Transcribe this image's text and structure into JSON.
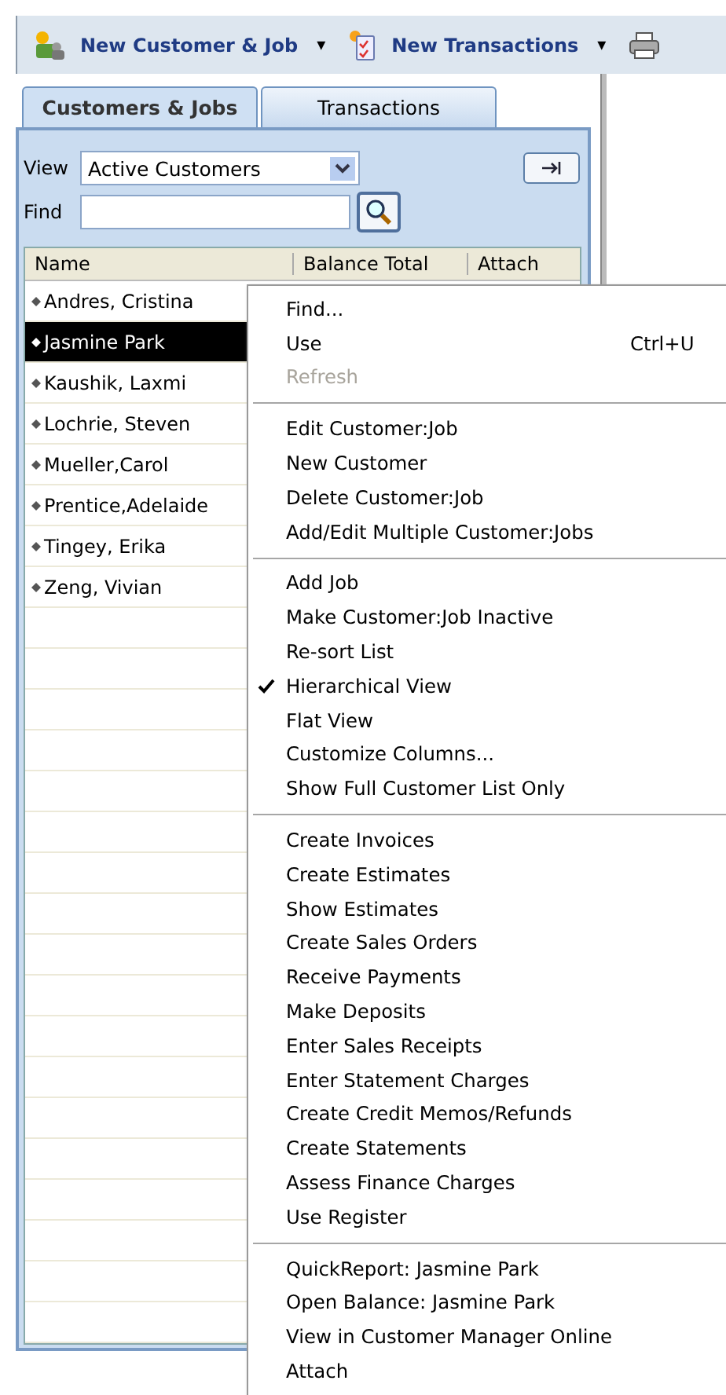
{
  "toolbar": {
    "buttons": [
      {
        "kind": "customer",
        "label": "New Customer & Job",
        "dropdown": "▾"
      },
      {
        "kind": "transaction",
        "label": "New Transactions",
        "dropdown": "▾"
      },
      {
        "kind": "print"
      }
    ]
  },
  "tabs": [
    {
      "label": "Customers & Jobs",
      "selected": true
    },
    {
      "label": "Transactions",
      "selected": false
    }
  ],
  "view": {
    "label": "View",
    "value": "Active Customers"
  },
  "find": {
    "label": "Find"
  },
  "table": {
    "columns": [
      "Name",
      "Balance Total",
      "Attach"
    ],
    "rows": [
      {
        "name": "Andres, Cristina",
        "selected": false
      },
      {
        "name": "Jasmine Park",
        "selected": true
      },
      {
        "name": "Kaushik, Laxmi",
        "selected": false
      },
      {
        "name": "Lochrie, Steven",
        "selected": false
      },
      {
        "name": "Mueller,Carol",
        "selected": false
      },
      {
        "name": "Prentice,Adelaide",
        "selected": false
      },
      {
        "name": "Tingey, Erika",
        "selected": false
      },
      {
        "name": "Zeng, Vivian",
        "selected": false
      }
    ]
  },
  "context_menu": {
    "groups": [
      [
        {
          "label": "Find...",
          "checked": false,
          "disabled": false
        },
        {
          "label": "Use",
          "shortcut": "Ctrl+U",
          "checked": false,
          "disabled": false
        },
        {
          "label": "Refresh",
          "checked": false,
          "disabled": true
        }
      ],
      [
        {
          "label": "Edit Customer:Job",
          "checked": false,
          "disabled": false
        },
        {
          "label": "New Customer",
          "checked": false,
          "disabled": false
        },
        {
          "label": "Delete Customer:Job",
          "checked": false,
          "disabled": false
        },
        {
          "label": "Add/Edit Multiple Customer:Jobs",
          "checked": false,
          "disabled": false
        }
      ],
      [
        {
          "label": "Add Job",
          "checked": false,
          "disabled": false
        },
        {
          "label": "Make Customer:Job Inactive",
          "checked": false,
          "disabled": false
        },
        {
          "label": "Re-sort List",
          "checked": false,
          "disabled": false
        },
        {
          "label": "Hierarchical View",
          "checked": true,
          "disabled": false
        },
        {
          "label": "Flat View",
          "checked": false,
          "disabled": false
        },
        {
          "label": "Customize Columns...",
          "checked": false,
          "disabled": false
        },
        {
          "label": "Show Full Customer List Only",
          "checked": false,
          "disabled": false
        }
      ],
      [
        {
          "label": "Create Invoices",
          "checked": false,
          "disabled": false
        },
        {
          "label": "Create Estimates",
          "checked": false,
          "disabled": false
        },
        {
          "label": "Show Estimates",
          "checked": false,
          "disabled": false
        },
        {
          "label": "Create Sales Orders",
          "checked": false,
          "disabled": false
        },
        {
          "label": "Receive Payments",
          "checked": false,
          "disabled": false
        },
        {
          "label": "Make Deposits",
          "checked": false,
          "disabled": false
        },
        {
          "label": "Enter Sales Receipts",
          "checked": false,
          "disabled": false
        },
        {
          "label": "Enter Statement Charges",
          "checked": false,
          "disabled": false
        },
        {
          "label": "Create Credit Memos/Refunds",
          "checked": false,
          "disabled": false
        },
        {
          "label": "Create Statements",
          "checked": false,
          "disabled": false
        },
        {
          "label": "Assess Finance Charges",
          "checked": false,
          "disabled": false
        },
        {
          "label": "Use Register",
          "checked": false,
          "disabled": false
        }
      ],
      [
        {
          "label": "QuickReport: Jasmine Park",
          "checked": false,
          "disabled": false
        },
        {
          "label": "Open Balance: Jasmine Park",
          "checked": false,
          "disabled": false
        },
        {
          "label": "View in Customer Manager Online",
          "checked": false,
          "disabled": false
        },
        {
          "label": "Attach",
          "checked": false,
          "disabled": false
        }
      ]
    ]
  }
}
